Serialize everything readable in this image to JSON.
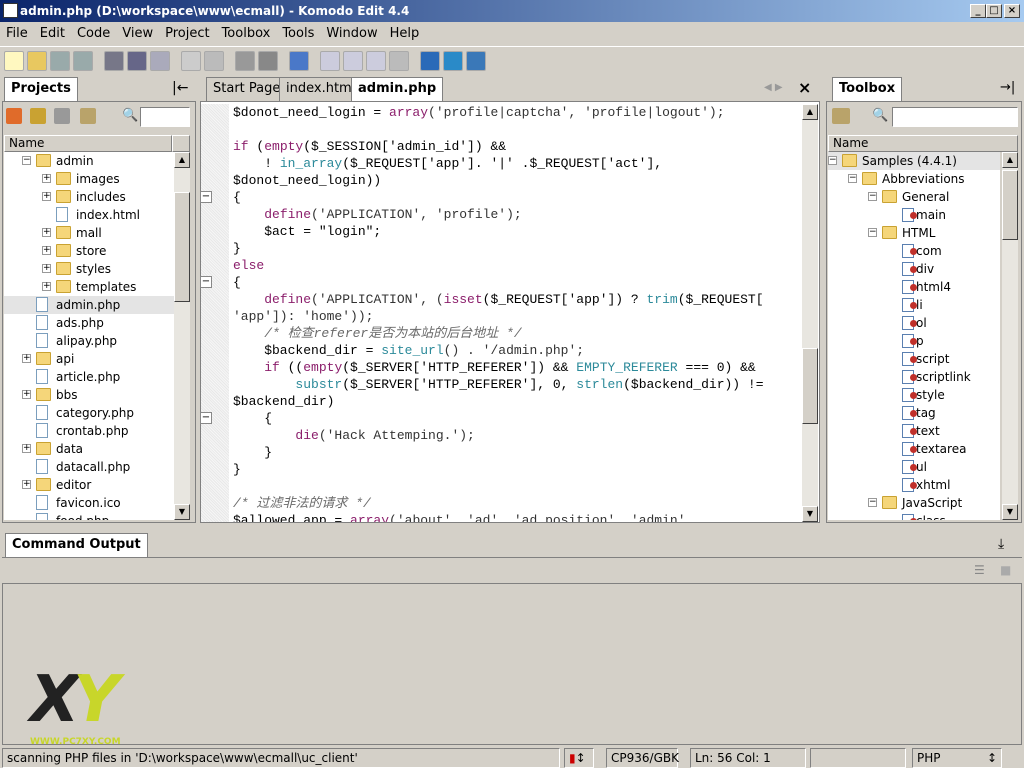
{
  "window": {
    "title": "admin.php (D:\\workspace\\www\\ecmall) - Komodo Edit 4.4"
  },
  "menu": [
    "File",
    "Edit",
    "Code",
    "View",
    "Project",
    "Toolbox",
    "Tools",
    "Window",
    "Help"
  ],
  "projects": {
    "tab": "Projects",
    "column": "Name",
    "items": [
      {
        "label": "admin",
        "level": 1,
        "type": "folder",
        "exp": "-"
      },
      {
        "label": "images",
        "level": 2,
        "type": "folder",
        "exp": "+"
      },
      {
        "label": "includes",
        "level": 2,
        "type": "folder",
        "exp": "+"
      },
      {
        "label": "index.html",
        "level": 2,
        "type": "file",
        "exp": ""
      },
      {
        "label": "mall",
        "level": 2,
        "type": "folder",
        "exp": "+"
      },
      {
        "label": "store",
        "level": 2,
        "type": "folder",
        "exp": "+"
      },
      {
        "label": "styles",
        "level": 2,
        "type": "folder",
        "exp": "+"
      },
      {
        "label": "templates",
        "level": 2,
        "type": "folder",
        "exp": "+"
      },
      {
        "label": "admin.php",
        "level": 1,
        "type": "file",
        "exp": "",
        "selected": true
      },
      {
        "label": "ads.php",
        "level": 1,
        "type": "file",
        "exp": ""
      },
      {
        "label": "alipay.php",
        "level": 1,
        "type": "file",
        "exp": ""
      },
      {
        "label": "api",
        "level": 1,
        "type": "folder",
        "exp": "+"
      },
      {
        "label": "article.php",
        "level": 1,
        "type": "file",
        "exp": ""
      },
      {
        "label": "bbs",
        "level": 1,
        "type": "folder",
        "exp": "+"
      },
      {
        "label": "category.php",
        "level": 1,
        "type": "file",
        "exp": ""
      },
      {
        "label": "crontab.php",
        "level": 1,
        "type": "file",
        "exp": ""
      },
      {
        "label": "data",
        "level": 1,
        "type": "folder",
        "exp": "+"
      },
      {
        "label": "datacall.php",
        "level": 1,
        "type": "file",
        "exp": ""
      },
      {
        "label": "editor",
        "level": 1,
        "type": "folder",
        "exp": "+"
      },
      {
        "label": "favicon.ico",
        "level": 1,
        "type": "file",
        "exp": ""
      },
      {
        "label": "food.php",
        "level": 1,
        "type": "file",
        "exp": ""
      }
    ]
  },
  "editor": {
    "tabs": [
      "Start Page",
      "index.html",
      "admin.php"
    ],
    "active_tab": 2,
    "lines": [
      [
        [
          "$donot_need_login = ",
          "n"
        ],
        [
          "array",
          "k"
        ],
        [
          "('profile|captcha', 'profile|logout');",
          "s"
        ]
      ],
      [],
      [
        [
          "if ",
          "k"
        ],
        [
          "(",
          "n"
        ],
        [
          "empty",
          "k"
        ],
        [
          "($_SESSION['admin_id']) &&",
          "n"
        ]
      ],
      [
        [
          "    ! ",
          "n"
        ],
        [
          "in_array",
          "f"
        ],
        [
          "($_REQUEST['app']. '|' .$_REQUEST['act'],",
          "n"
        ]
      ],
      [
        [
          "$donot_need_login))",
          "n"
        ]
      ],
      [
        [
          "{",
          "n"
        ]
      ],
      [
        [
          "    ",
          "n"
        ],
        [
          "define",
          "k"
        ],
        [
          "('APPLICATION', 'profile');",
          "s"
        ]
      ],
      [
        [
          "    $act = \"login\";",
          "n"
        ]
      ],
      [
        [
          "}",
          "n"
        ]
      ],
      [
        [
          "else",
          "k"
        ]
      ],
      [
        [
          "{",
          "n"
        ]
      ],
      [
        [
          "    ",
          "n"
        ],
        [
          "define",
          "k"
        ],
        [
          "('APPLICATION', (",
          "s"
        ],
        [
          "isset",
          "k"
        ],
        [
          "($_REQUEST['app']) ? ",
          "n"
        ],
        [
          "trim",
          "f"
        ],
        [
          "($_REQUEST[",
          "n"
        ]
      ],
      [
        [
          "'app']): 'home'));",
          "s"
        ]
      ],
      [
        [
          "    /* 检查referer是否为本站的后台地址 */",
          "c"
        ]
      ],
      [
        [
          "    $backend_dir = ",
          "n"
        ],
        [
          "site_url",
          "f"
        ],
        [
          "() . '/admin.php';",
          "s"
        ]
      ],
      [
        [
          "    ",
          "n"
        ],
        [
          "if",
          "k"
        ],
        [
          " ((",
          "n"
        ],
        [
          "empty",
          "k"
        ],
        [
          "($_SERVER['HTTP_REFERER']) && ",
          "n"
        ],
        [
          "EMPTY_REFERER",
          "f"
        ],
        [
          " === 0) &&",
          "n"
        ]
      ],
      [
        [
          "        ",
          "n"
        ],
        [
          "substr",
          "f"
        ],
        [
          "($_SERVER['HTTP_REFERER'], 0, ",
          "n"
        ],
        [
          "strlen",
          "f"
        ],
        [
          "($backend_dir)) !=",
          "n"
        ]
      ],
      [
        [
          "$backend_dir)",
          "n"
        ]
      ],
      [
        [
          "    {",
          "n"
        ]
      ],
      [
        [
          "        ",
          "n"
        ],
        [
          "die",
          "k"
        ],
        [
          "('Hack Attemping.');",
          "s"
        ]
      ],
      [
        [
          "    }",
          "n"
        ]
      ],
      [
        [
          "}",
          "n"
        ]
      ],
      [],
      [
        [
          "/* 过滤非法的请求 */",
          "c"
        ]
      ],
      [
        [
          "$allowed_app = ",
          "n"
        ],
        [
          "array",
          "k"
        ],
        [
          "('about', 'ad', 'ad_position', 'admin',",
          "s"
        ]
      ]
    ]
  },
  "toolbox": {
    "tab": "Toolbox",
    "column": "Name",
    "items": [
      {
        "label": "Samples (4.4.1)",
        "level": 0,
        "type": "folder",
        "exp": "-",
        "selected": true
      },
      {
        "label": "Abbreviations",
        "level": 1,
        "type": "folder",
        "exp": "-"
      },
      {
        "label": "General",
        "level": 2,
        "type": "folder",
        "exp": "-"
      },
      {
        "label": "main",
        "level": 3,
        "type": "tool",
        "exp": ""
      },
      {
        "label": "HTML",
        "level": 2,
        "type": "folder",
        "exp": "-"
      },
      {
        "label": "com",
        "level": 3,
        "type": "tool",
        "exp": ""
      },
      {
        "label": "div",
        "level": 3,
        "type": "tool",
        "exp": ""
      },
      {
        "label": "html4",
        "level": 3,
        "type": "tool",
        "exp": ""
      },
      {
        "label": "li",
        "level": 3,
        "type": "tool",
        "exp": ""
      },
      {
        "label": "ol",
        "level": 3,
        "type": "tool",
        "exp": ""
      },
      {
        "label": "p",
        "level": 3,
        "type": "tool",
        "exp": ""
      },
      {
        "label": "script",
        "level": 3,
        "type": "tool",
        "exp": ""
      },
      {
        "label": "scriptlink",
        "level": 3,
        "type": "tool",
        "exp": ""
      },
      {
        "label": "style",
        "level": 3,
        "type": "tool",
        "exp": ""
      },
      {
        "label": "tag",
        "level": 3,
        "type": "tool",
        "exp": ""
      },
      {
        "label": "text",
        "level": 3,
        "type": "tool",
        "exp": ""
      },
      {
        "label": "textarea",
        "level": 3,
        "type": "tool",
        "exp": ""
      },
      {
        "label": "ul",
        "level": 3,
        "type": "tool",
        "exp": ""
      },
      {
        "label": "xhtml",
        "level": 3,
        "type": "tool",
        "exp": ""
      },
      {
        "label": "JavaScript",
        "level": 2,
        "type": "folder",
        "exp": "-"
      },
      {
        "label": "class",
        "level": 3,
        "type": "tool",
        "exp": ""
      }
    ]
  },
  "output": {
    "tab": "Command Output"
  },
  "watermark": {
    "logo": "XY",
    "url": "WWW.PC7XY.COM"
  },
  "status": {
    "message": "scanning PHP files in 'D:\\workspace\\www\\ecmall\\uc_client'",
    "encoding": "CP936/GBK",
    "position": "Ln: 56 Col: 1",
    "language": "PHP"
  }
}
